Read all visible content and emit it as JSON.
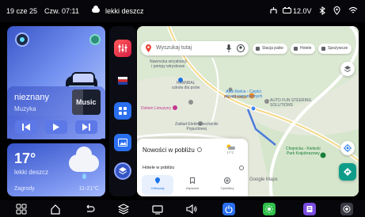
{
  "status_bar": {
    "date": "19 cze 25",
    "day_time": "Czw. 07:11",
    "weather": "lekki deszcz",
    "voltage": "12.0V"
  },
  "car_panel": {},
  "music": {
    "title": "nieznany",
    "artist": "Muzyka",
    "art_label": "Music"
  },
  "weather": {
    "temperature": "17°",
    "description": "lekki deszcz",
    "city": "Zagrody",
    "range": "11-21°C"
  },
  "map": {
    "search_placeholder": "Wyszukaj tutaj",
    "chips": [
      "Stacja paliw",
      "Hotele",
      "Spożywcze"
    ],
    "places": {
      "p1": "Nawrocka wiryaktacji\ni pompy wtryskowe",
      "p2": "HANNBAL\nszkoła dla psów",
      "p3": "Auto Kielce - Części\ndo aut zagranicznych",
      "p4": "Pub Obsesja",
      "p5": "AUTO FUN STEERING\nSOLUTIONS",
      "p6": "Dolium Limuzyny",
      "p7": "Zakład Elektromechaniki\nPojazdowej",
      "p8": "Chojnicka - Kielecki\nPark Krajobrazowy",
      "p9": "Google Maps"
    },
    "nearby": {
      "title": "Nowości w pobliżu",
      "weather_temp": "17°C",
      "subtitle": "Hotele w pobliżu",
      "tabs": [
        {
          "label": "Odkrywaj",
          "icon": "location-icon"
        },
        {
          "label": "Zapisane",
          "icon": "bookmark-icon"
        },
        {
          "label": "Opublikuj",
          "icon": "add-icon"
        }
      ]
    }
  },
  "colors": {
    "accent_blue": "#2a6ff0",
    "panel_gradient_start": "#3a56c8",
    "panel_gradient_end": "#a9bef9",
    "map_green": "#0f9d8a"
  }
}
